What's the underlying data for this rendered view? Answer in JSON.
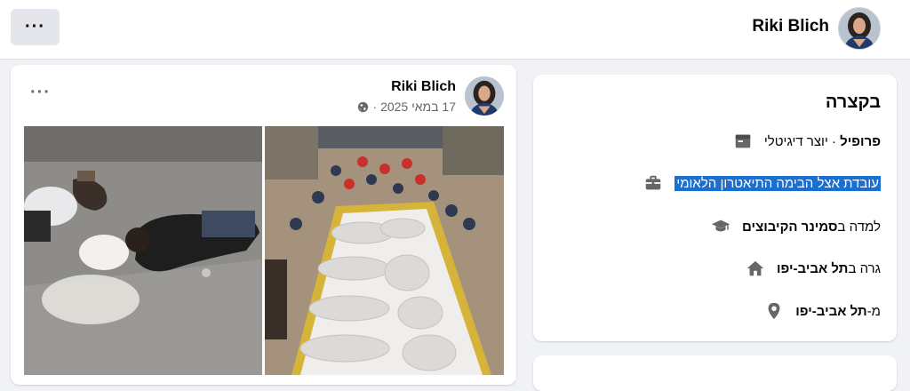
{
  "header": {
    "more_label": "···",
    "profile_name": "Riki Blich"
  },
  "post": {
    "more_label": "···",
    "author": "Riki Blich",
    "date": "17 במאי 2025",
    "separator": "·",
    "privacy_icon": "globe-icon"
  },
  "about": {
    "title": "בקצרה",
    "rows": [
      {
        "icon": "flag-icon",
        "bold": "פרופיל",
        "text": " · יוצר דיגיטלי"
      },
      {
        "icon": "briefcase-icon",
        "text": "עובדת אצל הבימה התיאטרון הלאומי"
      },
      {
        "icon": "graduation-cap-icon",
        "text": "למדה ב",
        "bold": "סמינר הקיבוצים"
      },
      {
        "icon": "home-icon",
        "text": "גרה ב",
        "bold": "תל אביב-יפו"
      },
      {
        "icon": "location-pin-icon",
        "text": "מ-",
        "bold": "תל אביב-יפו"
      }
    ]
  },
  "colors": {
    "accent": "#1a6fd1",
    "secondary_text": "#65676b",
    "icon_gray": "#65676b"
  }
}
